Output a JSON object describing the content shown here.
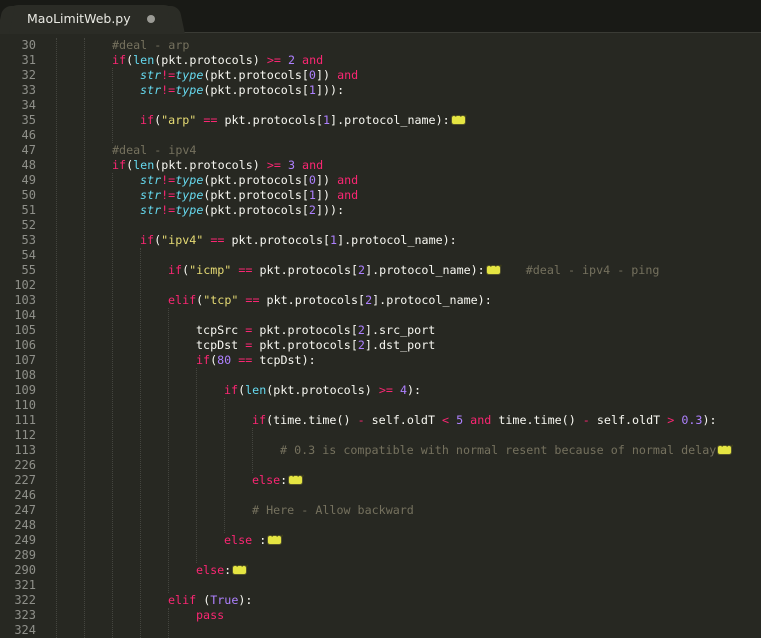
{
  "tab": {
    "title": "MaoLimitWeb.py",
    "modified": true
  },
  "colors": {
    "background": "#272822",
    "keyword": "#f92672",
    "function": "#66d9ef",
    "number": "#ae81ff",
    "string": "#e6db74",
    "comment": "#75715e",
    "text": "#f8f8f2",
    "fold_marker": "#e5e542"
  },
  "lines": [
    {
      "n": "30",
      "indent": 8,
      "tokens": [
        [
          "cm",
          "#deal - arp"
        ]
      ]
    },
    {
      "n": "31",
      "indent": 8,
      "tokens": [
        [
          "kw",
          "if"
        ],
        [
          "",
          "("
        ],
        [
          "fn",
          "len"
        ],
        [
          "",
          "(pkt.protocols) "
        ],
        [
          "op",
          ">="
        ],
        [
          "num",
          " 2"
        ],
        [
          "kw",
          " and"
        ]
      ]
    },
    {
      "n": "32",
      "indent": 12,
      "tokens": [
        [
          "ty",
          "str"
        ],
        [
          "op",
          "!="
        ],
        [
          "ty",
          "type"
        ],
        [
          "",
          "(pkt.protocols["
        ],
        [
          "num",
          "0"
        ],
        [
          "",
          "]) "
        ],
        [
          "kw",
          "and"
        ]
      ]
    },
    {
      "n": "33",
      "indent": 12,
      "tokens": [
        [
          "ty",
          "str"
        ],
        [
          "op",
          "!="
        ],
        [
          "ty",
          "type"
        ],
        [
          "",
          "(pkt.protocols["
        ],
        [
          "num",
          "1"
        ],
        [
          "",
          "])):"
        ]
      ]
    },
    {
      "n": "34",
      "indent": 0,
      "tokens": []
    },
    {
      "n": "35",
      "indent": 12,
      "tokens": [
        [
          "kw",
          "if"
        ],
        [
          "",
          "("
        ],
        [
          "str",
          "\"arp\""
        ],
        [
          "op",
          " =="
        ],
        [
          "",
          " pkt.protocols["
        ],
        [
          "num",
          "1"
        ],
        [
          "",
          "].protocol_name):"
        ]
      ],
      "fold": true
    },
    {
      "n": "46",
      "indent": 0,
      "tokens": []
    },
    {
      "n": "47",
      "indent": 8,
      "tokens": [
        [
          "cm",
          "#deal - ipv4"
        ]
      ]
    },
    {
      "n": "48",
      "indent": 8,
      "tokens": [
        [
          "kw",
          "if"
        ],
        [
          "",
          "("
        ],
        [
          "fn",
          "len"
        ],
        [
          "",
          "(pkt.protocols) "
        ],
        [
          "op",
          ">="
        ],
        [
          "num",
          " 3"
        ],
        [
          "kw",
          " and"
        ]
      ]
    },
    {
      "n": "49",
      "indent": 12,
      "tokens": [
        [
          "ty",
          "str"
        ],
        [
          "op",
          "!="
        ],
        [
          "ty",
          "type"
        ],
        [
          "",
          "(pkt.protocols["
        ],
        [
          "num",
          "0"
        ],
        [
          "",
          "]) "
        ],
        [
          "kw",
          "and"
        ]
      ]
    },
    {
      "n": "50",
      "indent": 12,
      "tokens": [
        [
          "ty",
          "str"
        ],
        [
          "op",
          "!="
        ],
        [
          "ty",
          "type"
        ],
        [
          "",
          "(pkt.protocols["
        ],
        [
          "num",
          "1"
        ],
        [
          "",
          "]) "
        ],
        [
          "kw",
          "and"
        ]
      ]
    },
    {
      "n": "51",
      "indent": 12,
      "tokens": [
        [
          "ty",
          "str"
        ],
        [
          "op",
          "!="
        ],
        [
          "ty",
          "type"
        ],
        [
          "",
          "(pkt.protocols["
        ],
        [
          "num",
          "2"
        ],
        [
          "",
          "])):"
        ]
      ]
    },
    {
      "n": "52",
      "indent": 0,
      "tokens": []
    },
    {
      "n": "53",
      "indent": 12,
      "tokens": [
        [
          "kw",
          "if"
        ],
        [
          "",
          "("
        ],
        [
          "str",
          "\"ipv4\""
        ],
        [
          "op",
          " =="
        ],
        [
          "",
          " pkt.protocols["
        ],
        [
          "num",
          "1"
        ],
        [
          "",
          "].protocol_name):"
        ]
      ]
    },
    {
      "n": "54",
      "indent": 0,
      "tokens": []
    },
    {
      "n": "55",
      "indent": 16,
      "tokens": [
        [
          "kw",
          "if"
        ],
        [
          "",
          "("
        ],
        [
          "str",
          "\"icmp\""
        ],
        [
          "op",
          " =="
        ],
        [
          "",
          " pkt.protocols["
        ],
        [
          "num",
          "2"
        ],
        [
          "",
          "].protocol_name):"
        ]
      ],
      "fold": true,
      "trailing_comment": "#deal - ipv4 - ping"
    },
    {
      "n": "102",
      "indent": 0,
      "tokens": []
    },
    {
      "n": "103",
      "indent": 16,
      "tokens": [
        [
          "kw",
          "elif"
        ],
        [
          "",
          "("
        ],
        [
          "str",
          "\"tcp\""
        ],
        [
          "op",
          " =="
        ],
        [
          "",
          " pkt.protocols["
        ],
        [
          "num",
          "2"
        ],
        [
          "",
          "].protocol_name):"
        ]
      ]
    },
    {
      "n": "104",
      "indent": 0,
      "tokens": []
    },
    {
      "n": "105",
      "indent": 20,
      "tokens": [
        [
          "",
          "tcpSrc "
        ],
        [
          "op",
          "="
        ],
        [
          "",
          " pkt.protocols["
        ],
        [
          "num",
          "2"
        ],
        [
          "",
          "].src_port"
        ]
      ]
    },
    {
      "n": "106",
      "indent": 20,
      "tokens": [
        [
          "",
          "tcpDst "
        ],
        [
          "op",
          "="
        ],
        [
          "",
          " pkt.protocols["
        ],
        [
          "num",
          "2"
        ],
        [
          "",
          "].dst_port"
        ]
      ]
    },
    {
      "n": "107",
      "indent": 20,
      "tokens": [
        [
          "kw",
          "if"
        ],
        [
          "",
          "("
        ],
        [
          "num",
          "80"
        ],
        [
          "op",
          " =="
        ],
        [
          "",
          " tcpDst):"
        ]
      ]
    },
    {
      "n": "108",
      "indent": 0,
      "tokens": []
    },
    {
      "n": "109",
      "indent": 24,
      "tokens": [
        [
          "kw",
          "if"
        ],
        [
          "",
          "("
        ],
        [
          "fn",
          "len"
        ],
        [
          "",
          "(pkt.protocols) "
        ],
        [
          "op",
          ">="
        ],
        [
          "num",
          " 4"
        ],
        [
          "",
          "):"
        ]
      ]
    },
    {
      "n": "110",
      "indent": 0,
      "tokens": []
    },
    {
      "n": "111",
      "indent": 28,
      "tokens": [
        [
          "kw",
          "if"
        ],
        [
          "",
          "(time.time() "
        ],
        [
          "op",
          "-"
        ],
        [
          "",
          " self.oldT "
        ],
        [
          "op",
          "<"
        ],
        [
          "num",
          " 5"
        ],
        [
          "kw",
          " and"
        ],
        [
          "",
          " time.time() "
        ],
        [
          "op",
          "-"
        ],
        [
          "",
          " self.oldT "
        ],
        [
          "op",
          ">"
        ],
        [
          "num",
          " 0.3"
        ],
        [
          "",
          "):"
        ]
      ]
    },
    {
      "n": "112",
      "indent": 0,
      "tokens": []
    },
    {
      "n": "113",
      "indent": 32,
      "tokens": [
        [
          "cm",
          "# 0.3 is compatible with normal resent because of normal delay"
        ]
      ],
      "fold": true
    },
    {
      "n": "226",
      "indent": 0,
      "tokens": []
    },
    {
      "n": "227",
      "indent": 28,
      "tokens": [
        [
          "kw",
          "else"
        ],
        [
          "",
          ":"
        ]
      ],
      "fold": true
    },
    {
      "n": "246",
      "indent": 0,
      "tokens": []
    },
    {
      "n": "247",
      "indent": 28,
      "tokens": [
        [
          "cm",
          "# Here - Allow backward"
        ]
      ]
    },
    {
      "n": "248",
      "indent": 0,
      "tokens": []
    },
    {
      "n": "249",
      "indent": 24,
      "tokens": [
        [
          "kw",
          "else"
        ],
        [
          "",
          " :"
        ]
      ],
      "fold": true
    },
    {
      "n": "289",
      "indent": 0,
      "tokens": []
    },
    {
      "n": "290",
      "indent": 20,
      "tokens": [
        [
          "kw",
          "else"
        ],
        [
          "",
          ":"
        ]
      ],
      "fold": true
    },
    {
      "n": "321",
      "indent": 0,
      "tokens": []
    },
    {
      "n": "322",
      "indent": 16,
      "tokens": [
        [
          "kw",
          "elif"
        ],
        [
          "",
          " ("
        ],
        [
          "num",
          "True"
        ],
        [
          "",
          "):"
        ]
      ]
    },
    {
      "n": "323",
      "indent": 20,
      "tokens": [
        [
          "kw",
          "pass"
        ]
      ]
    },
    {
      "n": "324",
      "indent": 0,
      "tokens": []
    }
  ]
}
